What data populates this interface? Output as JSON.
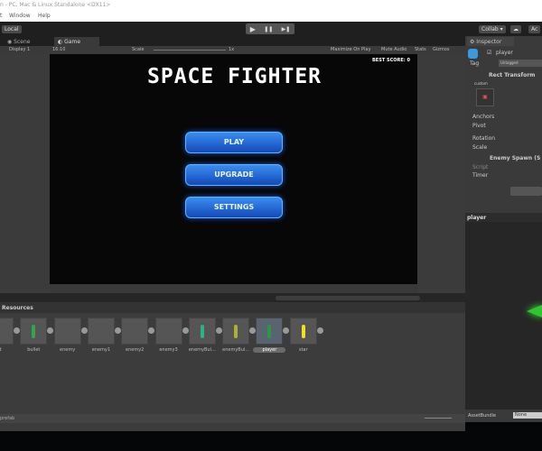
{
  "window": {
    "title": "n - PC, Mac & Linux Standalone <DX11>",
    "menu": [
      "t",
      "Window",
      "Help"
    ]
  },
  "toolbar": {
    "local": "Local",
    "play": "▶",
    "pause": "❚❚",
    "step": "▶❚",
    "collab": "Collab ▾",
    "account": "Ac"
  },
  "tabs": {
    "scene": "Scene",
    "game": "Game",
    "inspector": "Inspector"
  },
  "gamebar": {
    "display": "Display 1",
    "aspect": "16:10",
    "scale": "Scale",
    "scale_value": "1x",
    "maximize": "Maximize On Play",
    "mute": "Mute Audio",
    "stats": "Stats",
    "gizmos": "Gizmos"
  },
  "game": {
    "title": "SPACE FIGHTER",
    "best_score": "BEST SCORE: 0",
    "buttons": [
      "PLAY",
      "UPGRADE",
      "SETTINGS"
    ]
  },
  "project": {
    "folder": "Resources",
    "footer": "prefab",
    "assets": [
      {
        "label": "d",
        "color": ""
      },
      {
        "label": "bullet",
        "color": "#2fa84a"
      },
      {
        "label": "enemy",
        "color": ""
      },
      {
        "label": "enemy1",
        "color": ""
      },
      {
        "label": "enemy2",
        "color": ""
      },
      {
        "label": "enemy3",
        "color": ""
      },
      {
        "label": "enemyBul...",
        "color": "#2fb08a"
      },
      {
        "label": "enemyBul...",
        "color": "#b0b030"
      },
      {
        "label": "player",
        "color": "#2a9a3a"
      },
      {
        "label": "star",
        "color": "#f0e020"
      }
    ]
  },
  "inspector": {
    "object_name": "player",
    "tag_label": "Tag",
    "tag_value": "Untagged",
    "rect_transform": "Rect Transform",
    "custom": "custom",
    "anchors": "Anchors",
    "pivot": "Pivot",
    "rotation": "Rotation",
    "scale": "Scale",
    "component": "Enemy Spawn (S",
    "script": "Script",
    "timer": "Timer"
  },
  "preview": {
    "title": "player",
    "assetbundle": "AssetBundle",
    "assetbundle_value": "None"
  }
}
